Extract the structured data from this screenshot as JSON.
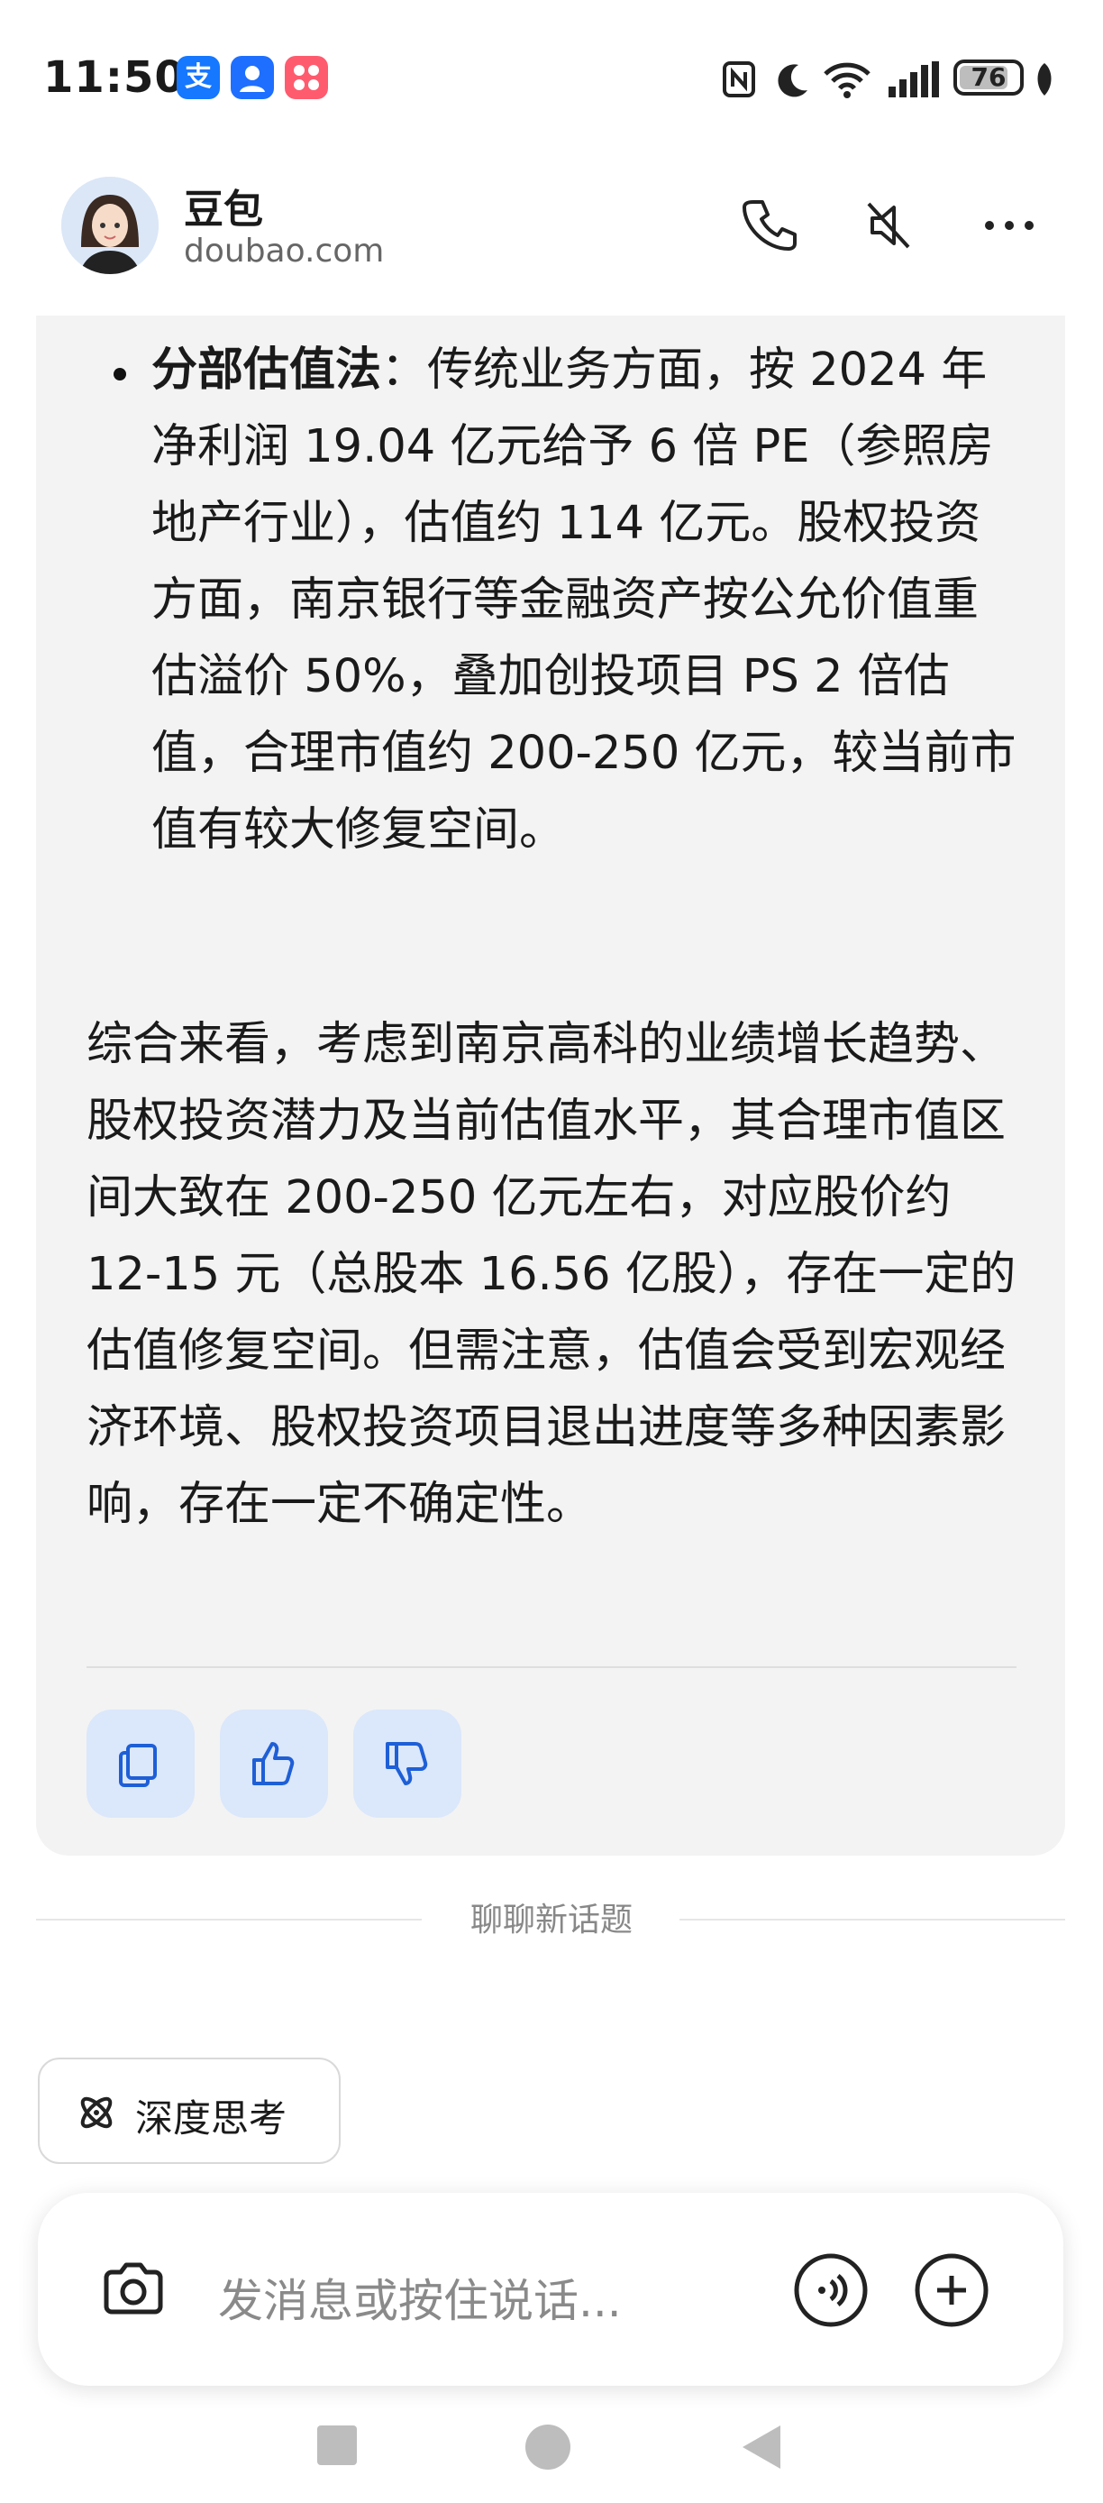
{
  "status_bar": {
    "time": "11:50",
    "app_icons": [
      {
        "name": "alipay-icon",
        "glyph": "支",
        "color": "#1677ff"
      },
      {
        "name": "contacts-app-icon",
        "glyph": "",
        "color": "#1e6fff"
      },
      {
        "name": "app-grid-icon",
        "glyph": "",
        "color": "#ff5b6e"
      }
    ],
    "battery": "76"
  },
  "header": {
    "title": "豆包",
    "subtitle": "doubao.com"
  },
  "message": {
    "bullet_title": "分部估值法",
    "bullet_body": "：传统业务方面，按 2024 年净利润 19.04 亿元给予 6 倍 PE（参照房地产行业），估值约 114 亿元。股权投资方面，南京银行等金融资产按公允价值重估溢价 50%，叠加创投项目 PS 2 倍估值，合理市值约 200-250 亿元，较当前市值有较大修复空间。",
    "summary": "综合来看，考虑到南京高科的业绩增长趋势、股权投资潜力及当前估值水平，其合理市值区间大致在 200-250 亿元左右，对应股价约 12-15 元（总股本 16.56 亿股），存在一定的估值修复空间。但需注意，估值会受到宏观经济环境、股权投资项目退出进度等多种因素影响，存在一定不确定性。"
  },
  "new_topic": "聊聊新话题",
  "deep_think": "深度思考",
  "input": {
    "placeholder": "发消息或按住说话..."
  },
  "colors": {
    "accent": "#1e5fd6",
    "action_bg": "#dbe7fb",
    "card_bg": "#f3f3f3"
  }
}
